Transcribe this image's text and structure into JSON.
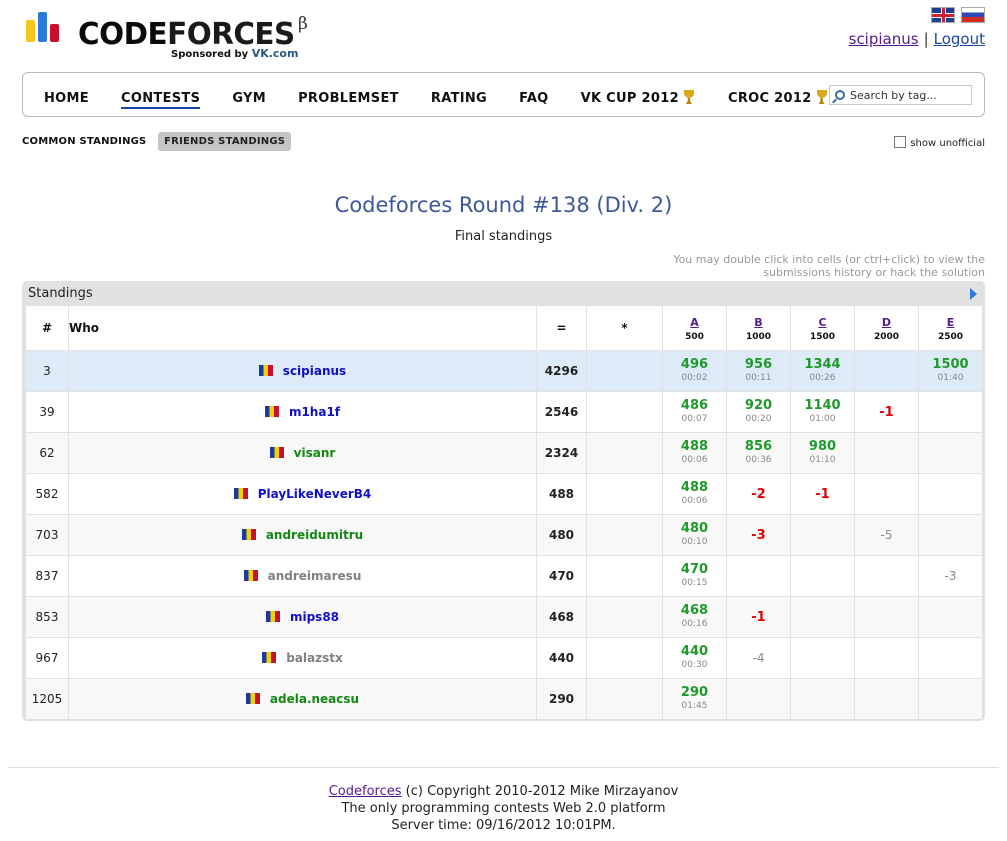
{
  "header": {
    "logo_text_cf": "CODE",
    "logo_text_forces": "FORCES",
    "logo_beta": "β",
    "sponsor_prefix": "Sponsored by",
    "sponsor_name": "VK.com",
    "username": "scipianus",
    "separator": "|",
    "logout": "Logout"
  },
  "menu": {
    "items": [
      "HOME",
      "CONTESTS",
      "GYM",
      "PROBLEMSET",
      "RATING",
      "FAQ",
      "VK CUP 2012",
      "CROC 2012"
    ],
    "active": "CONTESTS",
    "search_placeholder": "Search by tag..."
  },
  "subnav": {
    "common": "COMMON STANDINGS",
    "friends": "FRIENDS STANDINGS",
    "show_unofficial": "show unofficial"
  },
  "contest": {
    "title": "Codeforces Round #138 (Div. 2)",
    "status": "Final standings",
    "hint_line1": "You may double click into cells (or ctrl+click) to view the",
    "hint_line2": "submissions history or hack the solution"
  },
  "standings": {
    "caption": "Standings",
    "headers": {
      "rank": "#",
      "who": "Who",
      "score": "=",
      "penalty": "*"
    },
    "problems": [
      {
        "letter": "A",
        "points": "500"
      },
      {
        "letter": "B",
        "points": "1000"
      },
      {
        "letter": "C",
        "points": "1500"
      },
      {
        "letter": "D",
        "points": "2000"
      },
      {
        "letter": "E",
        "points": "2500"
      }
    ],
    "rows": [
      {
        "rank": "3",
        "who": "scipianus",
        "color": "#1010c8",
        "score": "4296",
        "cells": [
          {
            "s": "496",
            "t": "00:02"
          },
          {
            "s": "956",
            "t": "00:11"
          },
          {
            "s": "1344",
            "t": "00:26"
          },
          {
            "s": "",
            "t": ""
          },
          {
            "s": "1500",
            "t": "01:40"
          }
        ]
      },
      {
        "rank": "39",
        "who": "m1ha1f",
        "color": "#1010c8",
        "score": "2546",
        "cells": [
          {
            "s": "486",
            "t": "00:07"
          },
          {
            "s": "920",
            "t": "00:20"
          },
          {
            "s": "1140",
            "t": "01:00"
          },
          {
            "s": "-1",
            "t": "",
            "rej": true
          },
          {
            "s": "",
            "t": ""
          }
        ]
      },
      {
        "rank": "62",
        "who": "visanr",
        "color": "#138813",
        "score": "2324",
        "cells": [
          {
            "s": "488",
            "t": "00:06"
          },
          {
            "s": "856",
            "t": "00:36"
          },
          {
            "s": "980",
            "t": "01:10"
          },
          {
            "s": "",
            "t": ""
          },
          {
            "s": "",
            "t": ""
          }
        ]
      },
      {
        "rank": "582",
        "who": "PlayLikeNeverB4",
        "color": "#1010c8",
        "score": "488",
        "cells": [
          {
            "s": "488",
            "t": "00:06"
          },
          {
            "s": "-2",
            "t": "",
            "rej": true
          },
          {
            "s": "-1",
            "t": "",
            "rej": true
          },
          {
            "s": "",
            "t": ""
          },
          {
            "s": "",
            "t": ""
          }
        ]
      },
      {
        "rank": "703",
        "who": "andreidumitru",
        "color": "#138813",
        "score": "480",
        "cells": [
          {
            "s": "480",
            "t": "00:10"
          },
          {
            "s": "-3",
            "t": "",
            "rej": true
          },
          {
            "s": "",
            "t": ""
          },
          {
            "s": "-5",
            "t": "",
            "unoff": true
          },
          {
            "s": "",
            "t": ""
          }
        ]
      },
      {
        "rank": "837",
        "who": "andreimaresu",
        "color": "#808080",
        "score": "470",
        "cells": [
          {
            "s": "470",
            "t": "00:15"
          },
          {
            "s": "",
            "t": ""
          },
          {
            "s": "",
            "t": ""
          },
          {
            "s": "",
            "t": ""
          },
          {
            "s": "-3",
            "t": "",
            "unoff": true
          }
        ]
      },
      {
        "rank": "853",
        "who": "mips88",
        "color": "#1010c8",
        "score": "468",
        "cells": [
          {
            "s": "468",
            "t": "00:16"
          },
          {
            "s": "-1",
            "t": "",
            "rej": true
          },
          {
            "s": "",
            "t": ""
          },
          {
            "s": "",
            "t": ""
          },
          {
            "s": "",
            "t": ""
          }
        ]
      },
      {
        "rank": "967",
        "who": "balazstx",
        "color": "#808080",
        "score": "440",
        "cells": [
          {
            "s": "440",
            "t": "00:30"
          },
          {
            "s": "-4",
            "t": "",
            "unoff": true
          },
          {
            "s": "",
            "t": ""
          },
          {
            "s": "",
            "t": ""
          },
          {
            "s": "",
            "t": ""
          }
        ]
      },
      {
        "rank": "1205",
        "who": "adela.neacsu",
        "color": "#138813",
        "score": "290",
        "cells": [
          {
            "s": "290",
            "t": "01:45"
          },
          {
            "s": "",
            "t": ""
          },
          {
            "s": "",
            "t": ""
          },
          {
            "s": "",
            "t": ""
          },
          {
            "s": "",
            "t": ""
          }
        ]
      }
    ]
  },
  "footer": {
    "link": "Codeforces",
    "copyright": "(c) Copyright 2010-2012 Mike Mirzayanov",
    "tagline": "The only programming contests Web 2.0 platform",
    "server_time": "Server time: 09/16/2012 10:01PM."
  },
  "colors": {
    "accent": "#3b5998",
    "accepted": "#1f9a2a",
    "rejected": "#e00000",
    "highlight_row": "#dcebf7"
  }
}
